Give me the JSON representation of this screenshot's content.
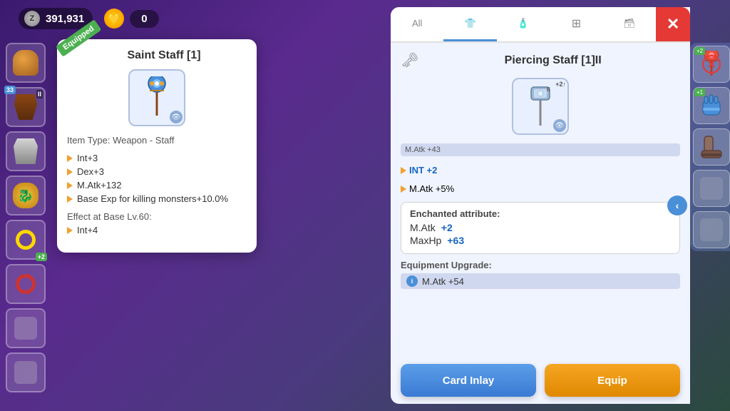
{
  "topBar": {
    "currencyIcon": "Z",
    "currencyValue": "391,931",
    "heartValue": "0"
  },
  "equippedCard": {
    "equippedLabel": "Equipped",
    "itemName": "Saint Staff [1]",
    "itemType": "Item Type: Weapon - Staff",
    "stats": [
      {
        "label": "Int+3"
      },
      {
        "label": "Dex+3"
      },
      {
        "label": "M.Atk+132"
      },
      {
        "label": "Base Exp for killing monsters+10.0%"
      }
    ],
    "effectLabel": "Effect at Base Lv.60:",
    "effectStats": [
      {
        "label": "Int+4"
      }
    ]
  },
  "comparisonPanel": {
    "tabs": [
      {
        "label": "All",
        "active": false
      },
      {
        "label": "👕",
        "active": true
      },
      {
        "label": "🧴",
        "active": false
      },
      {
        "label": "⊞",
        "active": false
      },
      {
        "label": "🖼",
        "active": false
      }
    ],
    "closeLabel": "✕",
    "itemName": "Piercing Staff [1]II",
    "mAtkBar": "M.Atk +43",
    "stats": [
      {
        "label": "INT +2",
        "type": "blue"
      },
      {
        "label": "M.Atk +5%",
        "type": "normal"
      }
    ],
    "enchantedTitle": "Enchanted attribute:",
    "enchantedStats": [
      {
        "name": "M.Atk",
        "value": "+2"
      },
      {
        "name": "MaxHp",
        "value": "+63"
      }
    ],
    "upgradeTitle": "Equipment Upgrade:",
    "upgradeValue": "M.Atk +54",
    "buttons": {
      "cardInlay": "Card Inlay",
      "equip": "Equip"
    }
  },
  "inventory": {
    "slots": [
      {
        "hasItem": true,
        "color": "#c0392b",
        "badge": "+2",
        "type": "weapon"
      },
      {
        "hasItem": true,
        "color": "#4a90d9",
        "badge": "+1",
        "type": "gloves"
      },
      {
        "hasItem": true,
        "color": "#8d6e63",
        "badge": "",
        "type": "boots"
      },
      {
        "hasItem": false
      },
      {
        "hasItem": false
      }
    ]
  },
  "leftItems": [
    {
      "type": "helmet",
      "equipped": true
    },
    {
      "type": "cloak",
      "badge": "33",
      "upgrade": "II"
    },
    {
      "type": "armor"
    },
    {
      "type": "dragon"
    },
    {
      "type": "ring-gold",
      "upgrade": "+2"
    },
    {
      "type": "ring-red"
    },
    {
      "type": "empty"
    },
    {
      "type": "empty"
    }
  ],
  "navArrow": "‹"
}
